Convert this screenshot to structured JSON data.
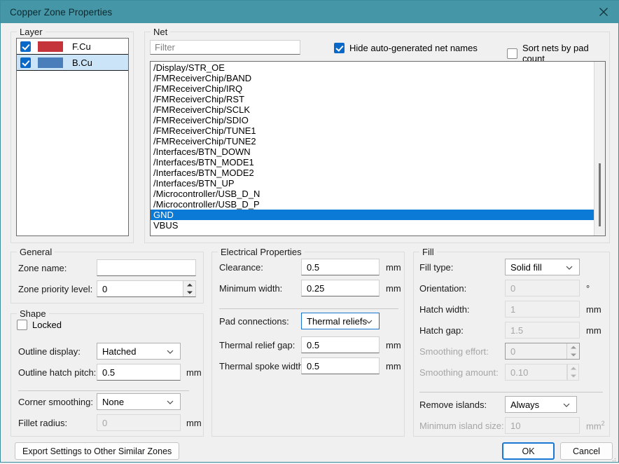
{
  "window": {
    "title": "Copper Zone Properties",
    "close_icon": "close-icon",
    "titlebar_color": "#4596a6"
  },
  "layer": {
    "group_title": "Layer",
    "items": [
      {
        "label": "F.Cu",
        "color": "#c4343a",
        "checked": true,
        "selected": false
      },
      {
        "label": "B.Cu",
        "color": "#4a7ebb",
        "checked": true,
        "selected": true
      }
    ]
  },
  "net": {
    "group_title": "Net",
    "filter": {
      "value": "",
      "placeholder": "Filter"
    },
    "hide_auto_generated": {
      "label": "Hide auto-generated net names",
      "checked": true
    },
    "sort_by_pad_count": {
      "label": "Sort nets by pad count",
      "checked": false
    },
    "items": [
      "/Display/STR_OE",
      "/FMReceiverChip/BAND",
      "/FMReceiverChip/IRQ",
      "/FMReceiverChip/RST",
      "/FMReceiverChip/SCLK",
      "/FMReceiverChip/SDIO",
      "/FMReceiverChip/TUNE1",
      "/FMReceiverChip/TUNE2",
      "/Interfaces/BTN_DOWN",
      "/Interfaces/BTN_MODE1",
      "/Interfaces/BTN_MODE2",
      "/Interfaces/BTN_UP",
      "/Microcontroller/USB_D_N",
      "/Microcontroller/USB_D_P",
      "GND",
      "VBUS"
    ],
    "selected": "GND",
    "selection_color": "#0a7ad6"
  },
  "general": {
    "group_title": "General",
    "zone_name": {
      "label": "Zone name:",
      "value": ""
    },
    "zone_priority": {
      "label": "Zone priority level:",
      "value": "0"
    }
  },
  "shape": {
    "group_title": "Shape",
    "locked": {
      "label": "Locked",
      "checked": false
    },
    "outline_display": {
      "label": "Outline display:",
      "value": "Hatched"
    },
    "outline_hatch_pitch": {
      "label": "Outline hatch pitch:",
      "value": "0.5",
      "unit": "mm"
    },
    "corner_smoothing": {
      "label": "Corner smoothing:",
      "value": "None"
    },
    "fillet_radius": {
      "label": "Fillet radius:",
      "value": "0",
      "unit": "mm",
      "disabled": true
    }
  },
  "electrical": {
    "group_title": "Electrical Properties",
    "clearance": {
      "label": "Clearance:",
      "value": "0.5",
      "unit": "mm"
    },
    "minimum_width": {
      "label": "Minimum width:",
      "value": "0.25",
      "unit": "mm"
    },
    "pad_connections": {
      "label": "Pad connections:",
      "value": "Thermal reliefs"
    },
    "thermal_relief_gap": {
      "label": "Thermal relief gap:",
      "value": "0.5",
      "unit": "mm"
    },
    "thermal_spoke_width": {
      "label": "Thermal spoke width:",
      "value": "0.5",
      "unit": "mm"
    }
  },
  "fill": {
    "group_title": "Fill",
    "fill_type": {
      "label": "Fill type:",
      "value": "Solid fill"
    },
    "orientation": {
      "label": "Orientation:",
      "value": "0",
      "unit": "°",
      "disabled": true
    },
    "hatch_width": {
      "label": "Hatch width:",
      "value": "1",
      "unit": "mm",
      "disabled": true
    },
    "hatch_gap": {
      "label": "Hatch gap:",
      "value": "1.5",
      "unit": "mm",
      "disabled": true
    },
    "smoothing_effort": {
      "label": "Smoothing effort:",
      "value": "0",
      "disabled": true
    },
    "smoothing_amount": {
      "label": "Smoothing amount:",
      "value": "0.10",
      "disabled": true
    },
    "remove_islands": {
      "label": "Remove islands:",
      "value": "Always"
    },
    "minimum_island_size": {
      "label": "Minimum island size:",
      "value": "10",
      "unit": "mm",
      "unit_sup": "2",
      "disabled": true
    }
  },
  "buttons": {
    "export": "Export Settings to Other Similar Zones",
    "ok": "OK",
    "cancel": "Cancel"
  }
}
